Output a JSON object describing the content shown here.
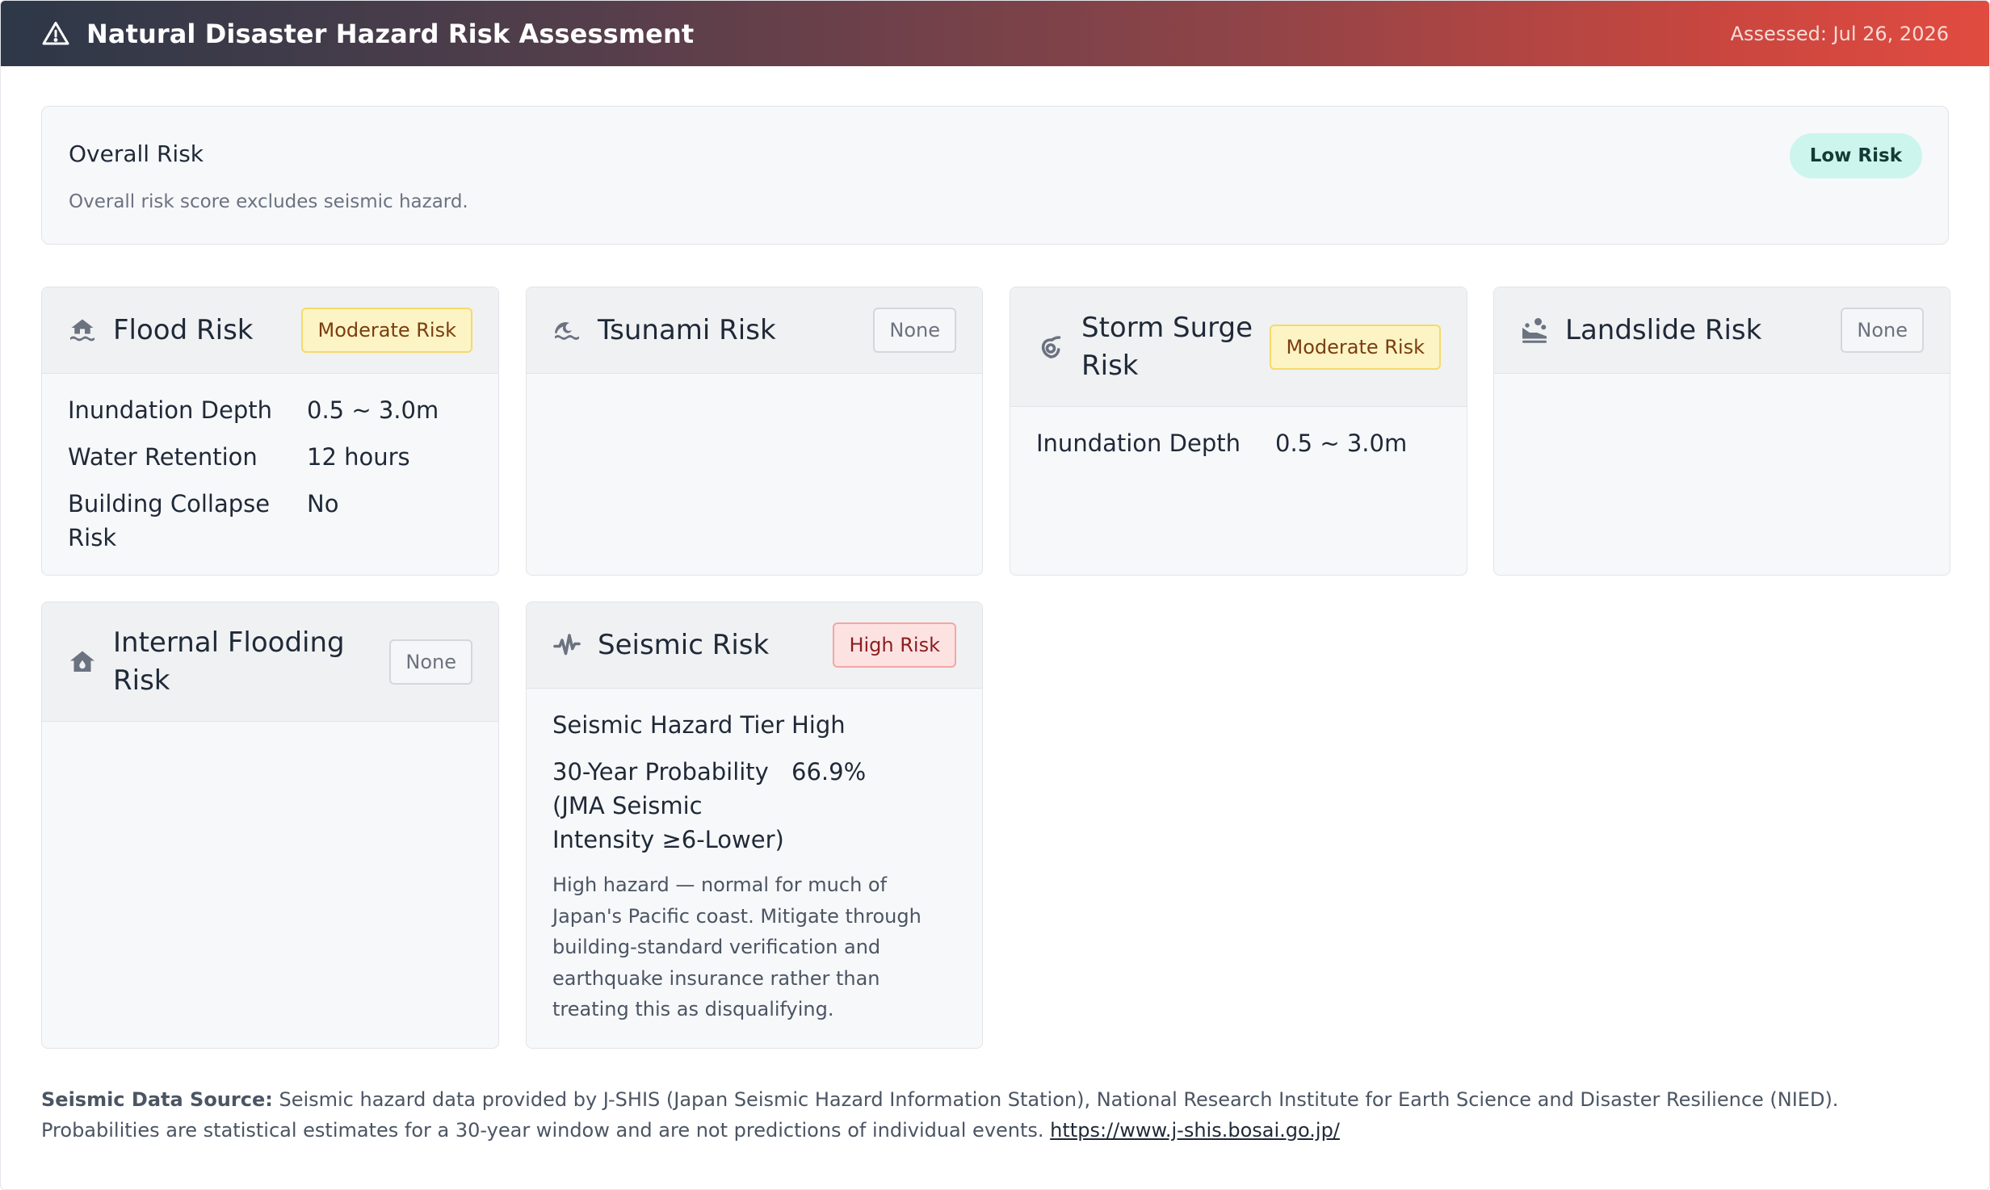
{
  "header": {
    "title": "Natural Disaster Hazard Risk Assessment",
    "assessed": "Assessed: Jul 26, 2026",
    "icon": "warning-triangle-icon"
  },
  "overall": {
    "title": "Overall Risk",
    "badge": "Low Risk",
    "note": "Overall risk score excludes seismic hazard."
  },
  "cards": {
    "flood": {
      "icon": "flood-house-icon",
      "title": "Flood Risk",
      "badge": "Moderate Risk",
      "rows": [
        {
          "label": "Inundation Depth",
          "value": "0.5 ~ 3.0m"
        },
        {
          "label": "Water Retention",
          "value": "12 hours"
        },
        {
          "label": "Building Collapse Risk",
          "value": "No"
        }
      ]
    },
    "tsunami": {
      "icon": "wave-icon",
      "title": "Tsunami Risk",
      "badge": "None"
    },
    "storm_surge": {
      "icon": "hurricane-icon",
      "title": "Storm Surge Risk",
      "badge": "Moderate Risk",
      "rows": [
        {
          "label": "Inundation Depth",
          "value": "0.5 ~ 3.0m"
        }
      ]
    },
    "landslide": {
      "icon": "landslide-icon",
      "title": "Landslide Risk",
      "badge": "None"
    },
    "internal_flooding": {
      "icon": "house-water-icon",
      "title": "Internal Flooding Risk",
      "badge": "None"
    },
    "seismic": {
      "icon": "seismic-wave-icon",
      "title": "Seismic Risk",
      "badge": "High Risk",
      "rows": [
        {
          "label": "Seismic Hazard Tier",
          "value": "High"
        },
        {
          "label": "30-Year Probability (JMA Seismic Intensity ≥6-Lower)",
          "value": "66.9%"
        }
      ],
      "note": "High hazard — normal for much of Japan's Pacific coast. Mitigate through building-standard verification and earthquake insurance rather than treating this as disqualifying."
    }
  },
  "footer": {
    "label": "Seismic Data Source:",
    "text": " Seismic hazard data provided by J-SHIS (Japan Seismic Hazard Information Station), National Research Institute for Earth Science and Disaster Resilience (NIED). Probabilities are statistical estimates for a 30-year window and are not predictions of individual events. ",
    "link": "https://www.j-shis.bosai.go.jp/"
  }
}
